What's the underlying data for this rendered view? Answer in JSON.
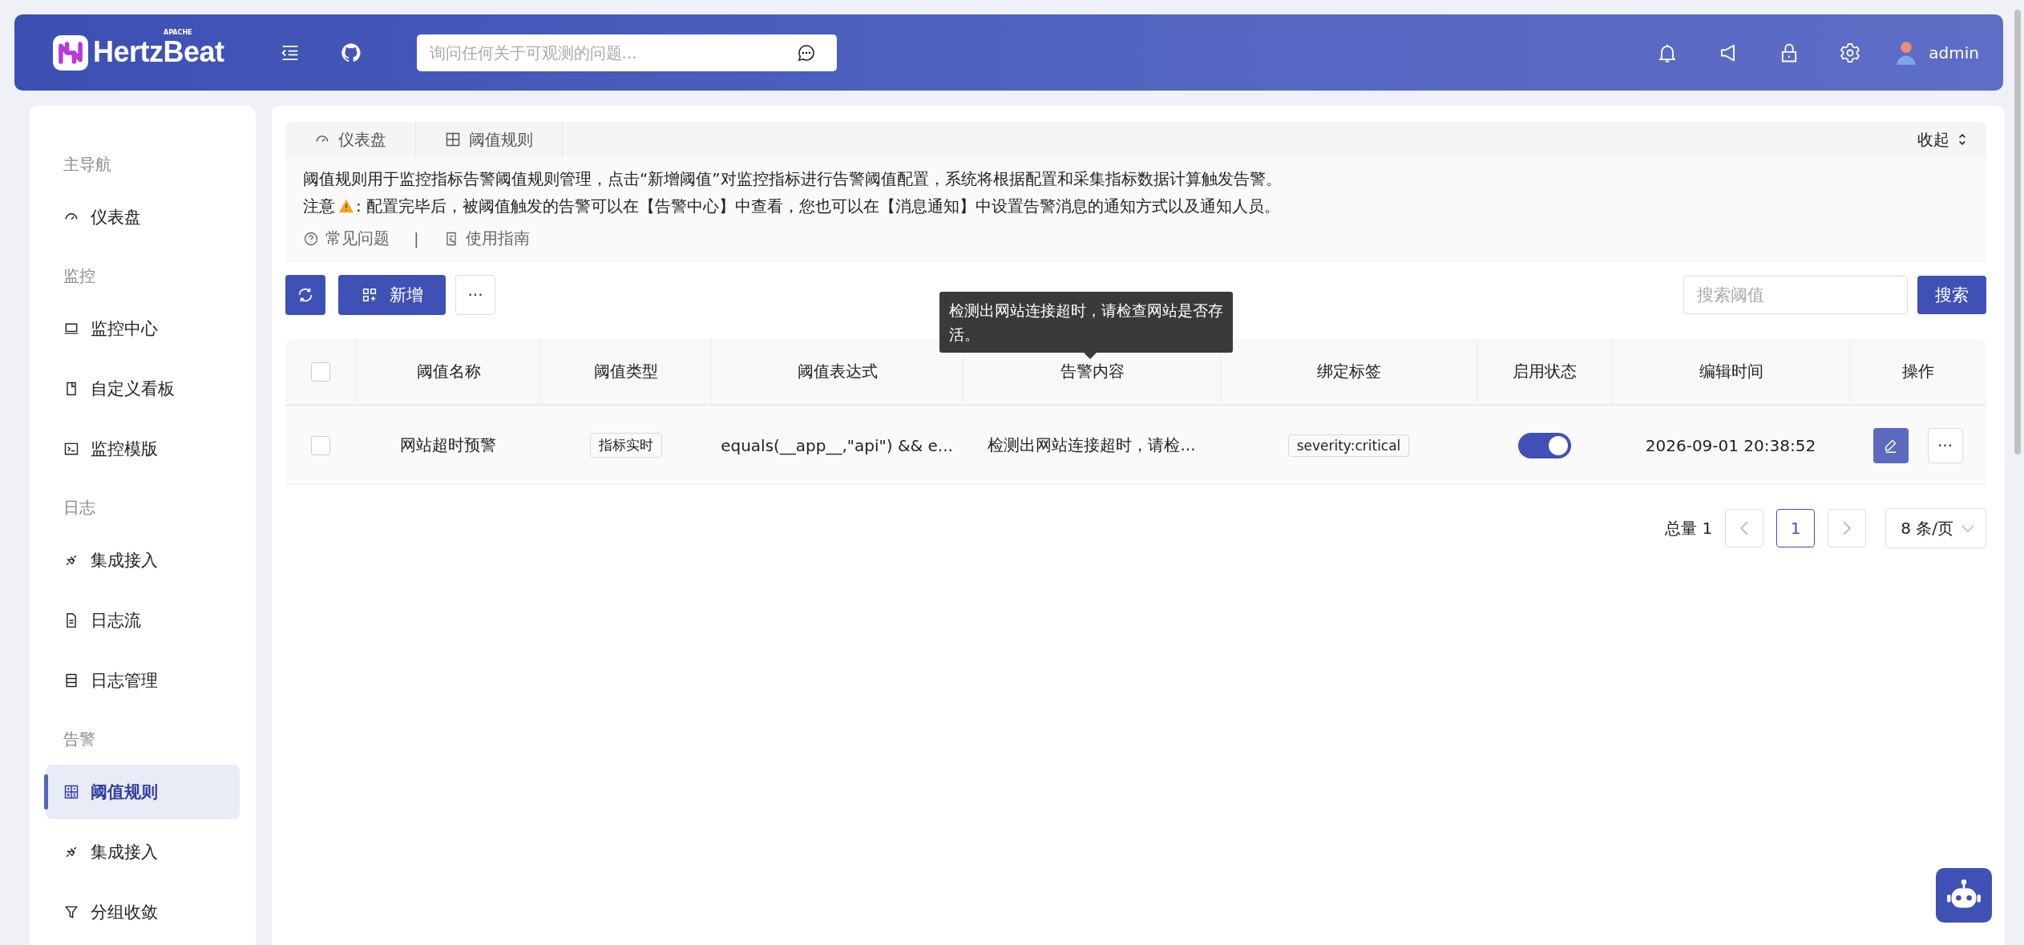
{
  "header": {
    "logo_text": "HertzBeat",
    "logo_tag": "APACHE",
    "search": {
      "placeholder": "询问任何关于可观测的问题..."
    },
    "user": "admin"
  },
  "sidebar": {
    "sections": [
      {
        "label": "主导航",
        "items": [
          {
            "label": "仪表盘",
            "selected": false
          }
        ]
      },
      {
        "label": "监控",
        "items": [
          {
            "label": "监控中心",
            "selected": false
          },
          {
            "label": "自定义看板",
            "selected": false
          },
          {
            "label": "监控模版",
            "selected": false
          }
        ]
      },
      {
        "label": "日志",
        "items": [
          {
            "label": "集成接入",
            "selected": false
          },
          {
            "label": "日志流",
            "selected": false
          },
          {
            "label": "日志管理",
            "selected": false
          }
        ]
      },
      {
        "label": "告警",
        "items": [
          {
            "label": "阈值规则",
            "selected": true
          },
          {
            "label": "集成接入",
            "selected": false
          },
          {
            "label": "分组收敛",
            "selected": false
          }
        ]
      }
    ]
  },
  "tabs": [
    {
      "label": "仪表盘",
      "selected": false
    },
    {
      "label": "阈值规则",
      "selected": false
    }
  ],
  "collapse": "收起",
  "description": {
    "line_1": "阈值规则用于监控指标告警阈值规则管理，点击“新增阈值”对监控指标进行告警阈值配置，系统将根据配置和采集指标数据计算触发告警。",
    "line_2_prefix": "注意",
    "line_2": ": 配置完毕后，被阈值触发的告警可以在【告警中心】中查看，您也可以在【消息通知】中设置告警消息的通知方式以及通知人员。",
    "links": [
      "常见问题",
      "使用指南"
    ],
    "separator": "|"
  },
  "toolbar": {
    "add": "新增",
    "more": "···",
    "search": {
      "placeholder": "搜索阈值"
    },
    "search_button": "搜索"
  },
  "table": {
    "all_checked": false,
    "columns": [
      "阈值名称",
      "阈值类型",
      "阈值表达式",
      "告警内容",
      "绑定标签",
      "启用状态",
      "编辑时间",
      "操作"
    ],
    "rows": [
      {
        "checked": false,
        "name": "网站超时预警",
        "type": "指标实时",
        "expression": "equals(__app__,\"api\") && e...",
        "content": "检测出网站连接超时，请检...",
        "tag": "severity:critical",
        "enabled": true,
        "edited": "2026-09-01 20:38:52",
        "more": "···"
      }
    ]
  },
  "tooltip": "检测出网站连接超时，请检查网站是否存活。",
  "pagination": {
    "total": "总量 1",
    "pages": [
      {
        "label": "1",
        "selected": true
      }
    ],
    "page_size": "8 条/页"
  }
}
